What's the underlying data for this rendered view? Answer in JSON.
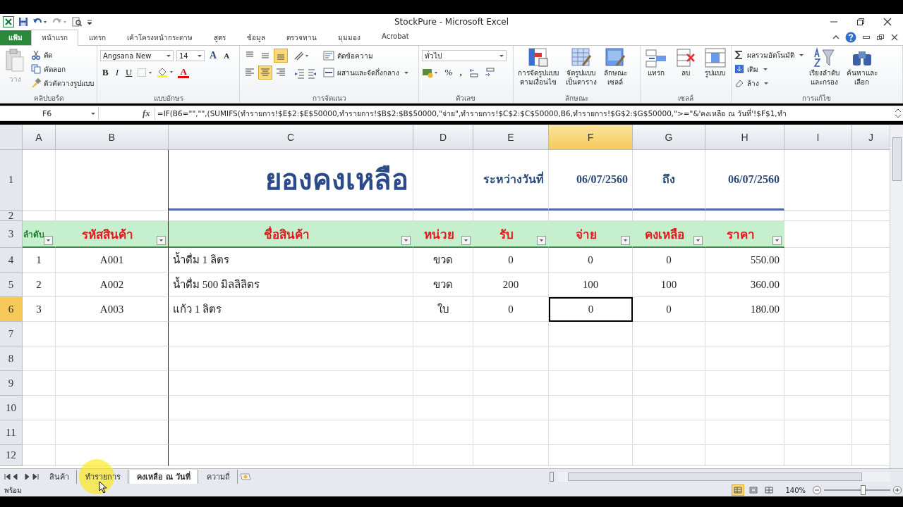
{
  "window": {
    "title": "StockPure  -  Microsoft Excel"
  },
  "ribbon_tabs": [
    {
      "label": "แฟ้ม",
      "kind": "file",
      "selected": false
    },
    {
      "label": "หน้าแรก",
      "kind": "tab",
      "selected": true
    },
    {
      "label": "แทรก",
      "kind": "tab",
      "selected": false
    },
    {
      "label": "เค้าโครงหน้ากระดาษ",
      "kind": "tab",
      "selected": false
    },
    {
      "label": "สูตร",
      "kind": "tab",
      "selected": false
    },
    {
      "label": "ข้อมูล",
      "kind": "tab",
      "selected": false
    },
    {
      "label": "ตรวจทาน",
      "kind": "tab",
      "selected": false
    },
    {
      "label": "มุมมอง",
      "kind": "tab",
      "selected": false
    },
    {
      "label": "Acrobat",
      "kind": "tab",
      "selected": false
    }
  ],
  "ribbon": [
    {
      "kind": "clipboard",
      "label": "คลิปบอร์ด",
      "paste": "วาง",
      "items": [
        {
          "kind": "cut",
          "label": "ตัด"
        },
        {
          "kind": "copy",
          "label": "คัดลอก"
        },
        {
          "kind": "painter",
          "label": "ตัวคัดวางรูปแบบ"
        }
      ]
    },
    {
      "kind": "font",
      "label": "แบบอักษร",
      "font_name": "Angsana New",
      "font_size": "14",
      "grow": "A",
      "shrink": "A",
      "bold": "B",
      "italic": "I",
      "underline": "U",
      "font_color": "A"
    },
    {
      "kind": "alignment",
      "label": "การจัดแนว",
      "buttons": [
        {
          "kind": "top",
          "on": false
        },
        {
          "kind": "middle",
          "on": false
        },
        {
          "kind": "bottom",
          "on": true
        },
        {
          "kind": "left",
          "on": false
        },
        {
          "kind": "center",
          "on": true
        },
        {
          "kind": "right",
          "on": false
        }
      ],
      "wrap": "ตัดข้อความ",
      "merge": "ผสานและจัดกึ่งกลาง"
    },
    {
      "kind": "number",
      "label": "ตัวเลข",
      "format": "ทั่วไป",
      "percent": "%",
      "comma": ","
    },
    {
      "kind": "styles",
      "label": "ลักษณะ",
      "items": [
        {
          "kind": "conditional",
          "label": "การจัดรูปแบบ",
          "sub": "ตามเงื่อนไข"
        },
        {
          "kind": "table",
          "label": "จัดรูปแบบ",
          "sub": "เป็นตาราง"
        },
        {
          "kind": "cellstyle",
          "label": "ลักษณะ",
          "sub": "เซลล์"
        }
      ]
    },
    {
      "kind": "cells",
      "label": "เซลล์",
      "items": [
        {
          "kind": "insert",
          "label": "แทรก"
        },
        {
          "kind": "delete",
          "label": "ลบ"
        },
        {
          "kind": "format",
          "label": "รูปแบบ"
        }
      ]
    },
    {
      "kind": "editing",
      "label": "การแก้ไข",
      "small": [
        {
          "kind": "sum",
          "label": "ผลรวมอัตโนมัติ"
        },
        {
          "kind": "fill",
          "label": "เติม"
        },
        {
          "kind": "clear",
          "label": "ล้าง"
        }
      ],
      "large": [
        {
          "kind": "sort",
          "label": "เรียงลำดับ",
          "sub": "และกรอง"
        },
        {
          "kind": "find",
          "label": "ค้นหาและ",
          "sub": "เลือก"
        }
      ]
    }
  ],
  "formula_bar": {
    "name_box": "F6",
    "fx": "fx",
    "formula": "=IF(B6=\"\",\"\",(SUMIFS(ทำรายการ!$E$2:$E$50000,ทำรายการ!$B$2:$B$50000,\"จ่าย\",ทำรายการ!$C$2:$C$50000,B6,ทำรายการ!$G$2:$G$50000,\">=\"&'คงเหลือ ณ วันที่'!$F$1,ทำ"
  },
  "sheet": {
    "columns": [
      {
        "letter": "A",
        "selected": false
      },
      {
        "letter": "B",
        "selected": false
      },
      {
        "letter": "C",
        "selected": false
      },
      {
        "letter": "D",
        "selected": false
      },
      {
        "letter": "E",
        "selected": false
      },
      {
        "letter": "F",
        "selected": true
      },
      {
        "letter": "G",
        "selected": false
      },
      {
        "letter": "H",
        "selected": false
      },
      {
        "letter": "I",
        "selected": false
      },
      {
        "letter": "J",
        "selected": false
      }
    ],
    "rows": [
      {
        "number": "1",
        "selected": false
      },
      {
        "number": "2",
        "selected": false
      },
      {
        "number": "3",
        "selected": false
      },
      {
        "number": "4",
        "selected": false
      },
      {
        "number": "5",
        "selected": false
      },
      {
        "number": "6",
        "selected": true
      },
      {
        "number": "7",
        "selected": false
      },
      {
        "number": "8",
        "selected": false
      },
      {
        "number": "9",
        "selected": false
      },
      {
        "number": "10",
        "selected": false
      },
      {
        "number": "11",
        "selected": false
      },
      {
        "number": "12",
        "selected": false
      }
    ],
    "title": "ยองคงเหลือ",
    "period_label": "ระหว่างวันที่",
    "date_from": "06/07/2560",
    "to_label": "ถึง",
    "date_to": "06/07/2560",
    "headers": [
      {
        "label": "ลำดับ",
        "color": "#1e7a2e"
      },
      {
        "label": "รหัสสินค้า",
        "color": "#e01a1a"
      },
      {
        "label": "ชื่อสินค้า",
        "color": "#e01a1a"
      },
      {
        "label": "หน่วย",
        "color": "#e01a1a"
      },
      {
        "label": "รับ",
        "color": "#e01a1a"
      },
      {
        "label": "จ่าย",
        "color": "#e01a1a"
      },
      {
        "label": "คงเหลือ",
        "color": "#e01a1a"
      },
      {
        "label": "ราคา",
        "color": "#e01a1a"
      }
    ],
    "data": [
      {
        "cells": [
          {
            "text": "1",
            "selected": false
          },
          {
            "text": "A001",
            "selected": false
          },
          {
            "text": "น้ำดื่ม 1 ลิตร",
            "selected": false
          },
          {
            "text": "ขวด",
            "selected": false
          },
          {
            "text": "0",
            "selected": false
          },
          {
            "text": "0",
            "selected": false
          },
          {
            "text": "0",
            "selected": false
          },
          {
            "text": "550.00",
            "selected": false
          }
        ]
      },
      {
        "cells": [
          {
            "text": "2",
            "selected": false
          },
          {
            "text": "A002",
            "selected": false
          },
          {
            "text": "น้ำดื่ม 500 มิลลิลิตร",
            "selected": false
          },
          {
            "text": "ขวด",
            "selected": false
          },
          {
            "text": "200",
            "selected": false
          },
          {
            "text": "100",
            "selected": false
          },
          {
            "text": "100",
            "selected": false
          },
          {
            "text": "360.00",
            "selected": false
          }
        ]
      },
      {
        "cells": [
          {
            "text": "3",
            "selected": false
          },
          {
            "text": "A003",
            "selected": false
          },
          {
            "text": "แก้ว 1 ลิตร",
            "selected": false
          },
          {
            "text": "ใบ",
            "selected": false
          },
          {
            "text": "0",
            "selected": false
          },
          {
            "text": "0",
            "selected": true
          },
          {
            "text": "0",
            "selected": false
          },
          {
            "text": "180.00",
            "selected": false
          }
        ]
      }
    ]
  },
  "sheet_tabs": [
    {
      "label": "สินค้า",
      "selected": false
    },
    {
      "label": "ทำรายการ",
      "selected": false
    },
    {
      "label": "คงเหลือ ณ วันที่",
      "selected": true
    },
    {
      "label": "ความถี่",
      "selected": false
    }
  ],
  "status_bar": {
    "status": "พร้อม",
    "views": [
      {
        "kind": "normal",
        "selected": true
      },
      {
        "kind": "layout",
        "selected": false
      },
      {
        "kind": "pagebreak",
        "selected": false
      }
    ],
    "zoom": "140%",
    "zoom_slider": {
      "level": 0.57
    }
  }
}
